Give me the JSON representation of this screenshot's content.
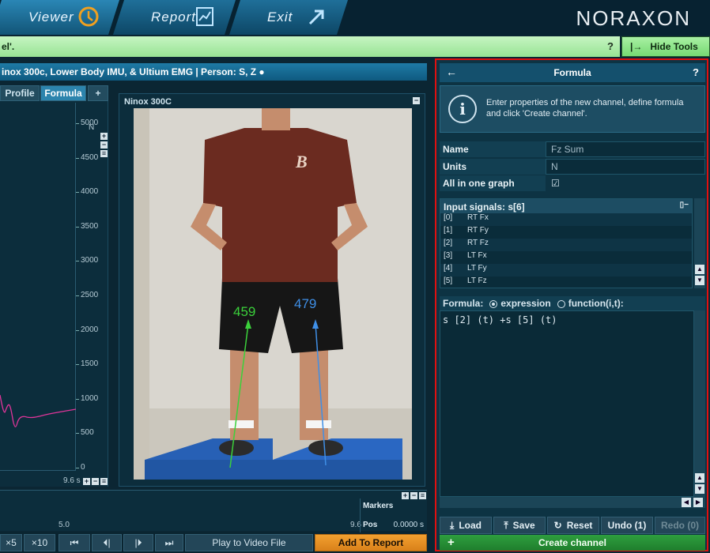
{
  "nav": {
    "viewer": "Viewer",
    "report": "Report",
    "exit": "Exit",
    "logo": "NORAXON"
  },
  "message": {
    "text": "el'.",
    "help": "?",
    "hide_tools": "Hide Tools"
  },
  "session_title": "inox 300c, Lower Body IMU, & Ultium EMG | Person: S, Z ●",
  "graph": {
    "tabs": {
      "profile": "Profile",
      "formula": "Formula",
      "add": "+"
    },
    "unit": "N",
    "yticks": [
      "5000",
      "4500",
      "4000",
      "3500",
      "3000",
      "2500",
      "2000",
      "1500",
      "1000",
      "500",
      "0"
    ],
    "time_label": "9.6 s",
    "line_color": "#e0359a"
  },
  "video": {
    "title": "Ninox 300C",
    "force_left": "459",
    "force_right": "479",
    "left_color": "#3bd13b",
    "right_color": "#3f8fe6"
  },
  "timeline": {
    "tick_mid": "5.0",
    "tick_end": "9.6",
    "markers": "Markers",
    "pos_label": "Pos",
    "pos_value": "0.0000 s"
  },
  "bottom": {
    "x5": "×5",
    "x10": "×10",
    "play_to_file": "Play to Video File",
    "add_to_report": "Add To Report"
  },
  "formula_panel": {
    "title": "Formula",
    "back": "←",
    "help": "?",
    "info": "Enter properties of the new channel, define formula and click 'Create channel'.",
    "name_label": "Name",
    "name_value": "Fz Sum",
    "units_label": "Units",
    "units_value": "N",
    "all_in_one_label": "All in one graph",
    "all_in_one_checked": "☑",
    "input_signals_title": "Input signals: s[6]",
    "signals": [
      {
        "idx": "[0]",
        "name": "RT Fx"
      },
      {
        "idx": "[1]",
        "name": "RT Fy"
      },
      {
        "idx": "[2]",
        "name": "RT Fz"
      },
      {
        "idx": "[3]",
        "name": "LT Fx"
      },
      {
        "idx": "[4]",
        "name": "LT Fy"
      },
      {
        "idx": "[5]",
        "name": "LT Fz"
      }
    ],
    "formula_label": "Formula:",
    "mode_expression": "expression",
    "mode_function": "function(i,t):",
    "formula_text": "s [2] (t) +s [5] (t)",
    "load": "Load",
    "save": "Save",
    "reset": "Reset",
    "undo": "Undo (1)",
    "redo": "Redo (0)",
    "create_channel": "Create channel"
  }
}
